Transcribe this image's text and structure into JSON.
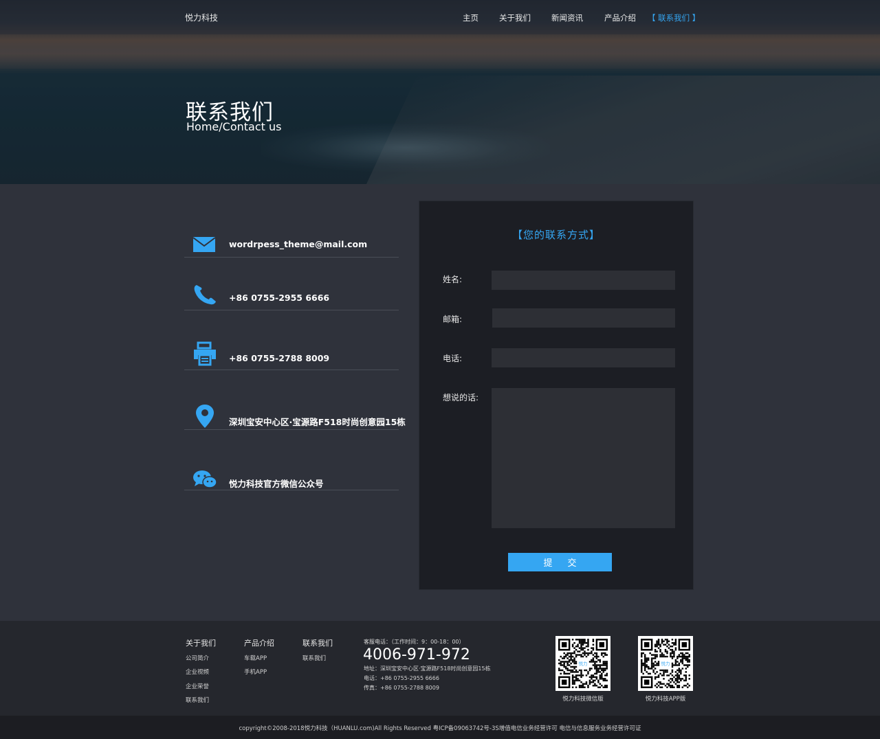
{
  "site": {
    "logo": "悦力科技"
  },
  "nav": [
    {
      "label": "主页"
    },
    {
      "label": "关于我们"
    },
    {
      "label": "新闻资讯"
    },
    {
      "label": "产品介绍"
    },
    {
      "label": "【 联系我们 】",
      "active": true
    }
  ],
  "hero": {
    "title": "联系我们",
    "subtitle": "Home/Contact us"
  },
  "contact": {
    "email": "wordrpess_theme@mail.com",
    "phone": "+86 0755-2955 6666",
    "fax": "+86 0755-2788 8009",
    "address": "深圳宝安中心区·宝源路F518时尚创意园15栋",
    "wechat": "悦力科技官方微信公众号"
  },
  "form": {
    "title": "【您的联系方式】",
    "name_label": "姓名:",
    "email_label": "邮箱:",
    "phone_label": "电话:",
    "message_label": "想说的话:",
    "name_value": "",
    "email_value": "",
    "phone_value": "",
    "message_value": "",
    "submit_label": "提交"
  },
  "footer": {
    "columns": [
      {
        "heading": "关于我们",
        "items": [
          "公司简介",
          "企业视频",
          "企业荣誉",
          "联系我们"
        ]
      },
      {
        "heading": "产品介绍",
        "items": [
          "车载APP",
          "手机APP"
        ]
      },
      {
        "heading": "联系我们",
        "items": [
          "联系我们"
        ]
      }
    ],
    "hotline_label": "客服电话：（工作时间：9：00-18：00）",
    "hotline": "4006-971-972",
    "address_line": "地址：深圳宝安中心区·宝源路F518时尚创意园15栋",
    "phone_line": "电话：+86 0755-2955 6666",
    "fax_line": "传真：+86 0755-2788 8009",
    "qr_wechat_caption": "悦力科技微信版",
    "qr_app_caption": "悦力科技APP版",
    "qr_logo_text": "悦力",
    "copyright": "copyright©2008-2018悦力科技（HUANLU.com)All Rights Reserved 粤ICP备09063742号-3S增值电信业务经营许可 电信与信息服务业务经营许可证"
  },
  "colors": {
    "accent": "#35a6f2",
    "page_bg": "#2f323b",
    "form_bg": "#1c1e24",
    "footer_bg": "#25272d"
  },
  "icons": [
    "mail-icon",
    "phone-icon",
    "fax-icon",
    "location-pin-icon",
    "wechat-icon",
    "qr-code-icon"
  ]
}
